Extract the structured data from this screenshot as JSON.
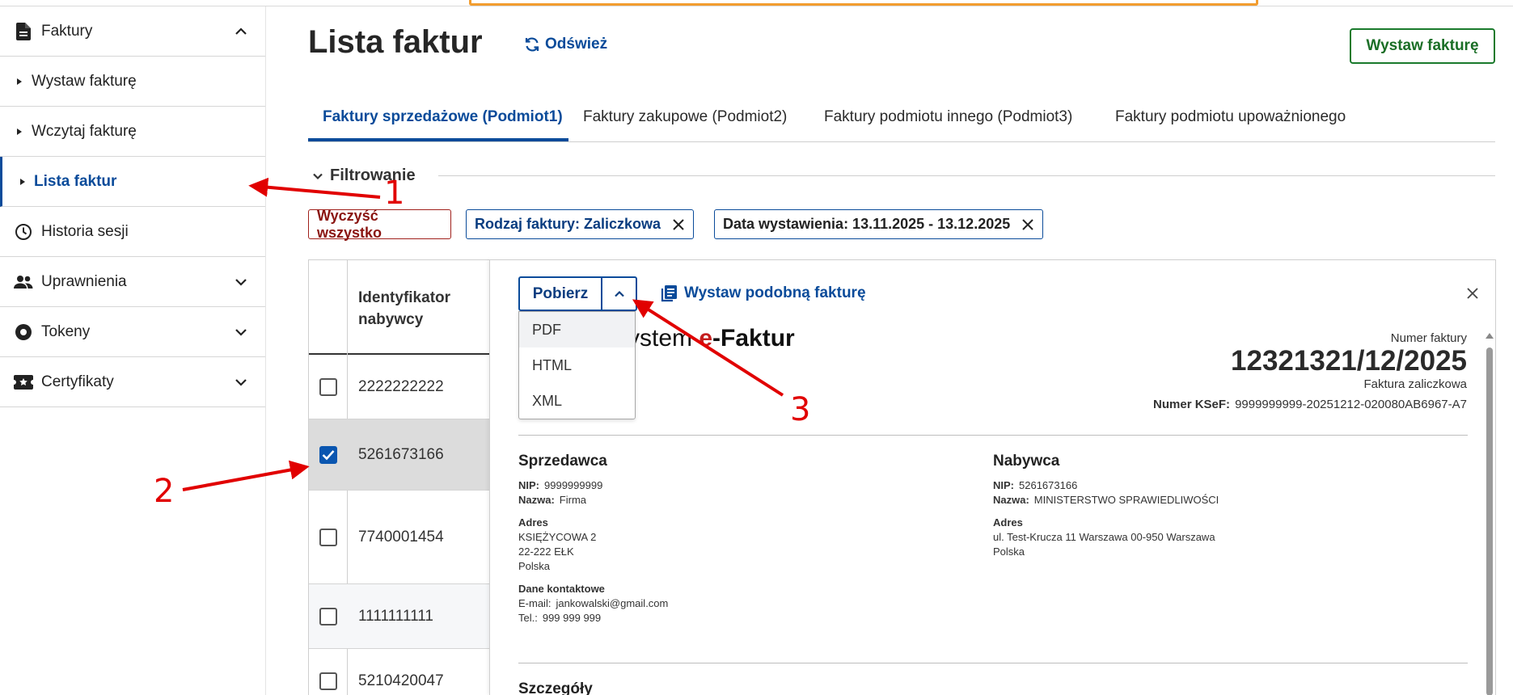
{
  "sidebar": {
    "faktury_label": "Faktury",
    "sub_items": [
      "Wystaw fakturę",
      "Wczytaj fakturę",
      "Lista faktur"
    ],
    "items": [
      "Historia sesji",
      "Uprawnienia",
      "Tokeny",
      "Certyfikaty"
    ]
  },
  "header": {
    "title": "Lista faktur",
    "refresh_label": "Odśwież",
    "issue_button": "Wystaw fakturę"
  },
  "tabs": [
    "Faktury sprzedażowe (Podmiot1)",
    "Faktury zakupowe (Podmiot2)",
    "Faktury podmiotu innego (Podmiot3)",
    "Faktury podmiotu upoważnionego"
  ],
  "filter": {
    "heading": "Filtrowanie",
    "clear_all": "Wyczyść wszystko",
    "chips": [
      "Rodzaj faktury: Zaliczkowa",
      "Data wystawienia: 13.11.2025 - 13.12.2025"
    ]
  },
  "table": {
    "header_line1": "Identyfikator",
    "header_line2": "nabywcy",
    "rows": [
      {
        "value": "2222222222",
        "checked": false
      },
      {
        "value": "5261673166",
        "checked": true
      },
      {
        "value": "7740001454",
        "checked": false
      },
      {
        "value": "1111111111",
        "checked": false
      },
      {
        "value": "5210420047",
        "checked": false
      }
    ]
  },
  "preview": {
    "download_button": "Pobierz",
    "dropdown_options": [
      "PDF",
      "HTML",
      "XML"
    ],
    "similar_invoice": "Wystaw podobną fakturę",
    "brand_prefix": "ystem ",
    "brand_e": "e",
    "brand_suffix": "-Faktur",
    "invoice_number_label": "Numer faktury",
    "invoice_number": "12321321/12/2025",
    "invoice_type": "Faktura zaliczkowa",
    "ksef_label": "Numer KSeF:",
    "ksef_value": "9999999999-20251212-020080AB6967-A7",
    "seller": {
      "title": "Sprzedawca",
      "nip_label": "NIP:",
      "nip": "9999999999",
      "name_label": "Nazwa:",
      "name": "Firma",
      "address_label": "Adres",
      "address_lines": [
        "KSIĘŻYCOWA 2",
        "22-222 EŁK",
        "Polska"
      ],
      "contact_label": "Dane kontaktowe",
      "email_label": "E-mail:",
      "email": "jankowalski@gmail.com",
      "phone_label": "Tel.:",
      "phone": "999 999 999"
    },
    "buyer": {
      "title": "Nabywca",
      "nip_label": "NIP:",
      "nip": "5261673166",
      "name_label": "Nazwa:",
      "name": "MINISTERSTWO SPRAWIEDLIWOŚCI",
      "address_label": "Adres",
      "address_lines": [
        "ul. Test-Krucza 11 Warszawa 00-950 Warszawa",
        "Polska"
      ]
    },
    "details_heading": "Szczegóły"
  },
  "annotations": [
    "1",
    "2",
    "3"
  ],
  "colors": {
    "primary": "#0a4b9a",
    "success": "#1a7a2c",
    "danger": "#a0201b",
    "annotation": "#e10000"
  }
}
